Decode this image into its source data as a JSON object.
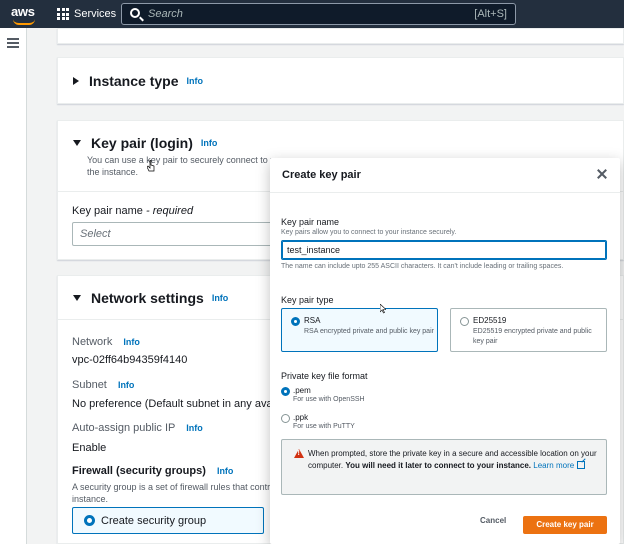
{
  "nav": {
    "logo": "aws",
    "services_label": "Services",
    "search_placeholder": "Search",
    "search_shortcut": "[Alt+S]"
  },
  "instance_type": {
    "title": "Instance type",
    "info": "Info"
  },
  "key_pair": {
    "title": "Key pair (login)",
    "info": "Info",
    "description_line1": "You can use a key pair to securely connect to y",
    "description_line2": "the instance.",
    "name_label": "Key pair name",
    "required": "- required",
    "select_placeholder": "Select"
  },
  "network": {
    "title": "Network settings",
    "info": "Info",
    "network_label": "Network",
    "network_info": "Info",
    "network_value": "vpc-02ff64b94359f4140",
    "subnet_label": "Subnet",
    "subnet_info": "Info",
    "subnet_value": "No preference (Default subnet in any availa",
    "public_ip_label": "Auto-assign public IP",
    "public_ip_info": "Info",
    "public_ip_value": "Enable",
    "firewall_label": "Firewall (security groups)",
    "firewall_info": "Info",
    "firewall_desc_line1": "A security group is a set of firewall rules that contr",
    "firewall_desc_line2": "instance.",
    "sg_option": "Create security group"
  },
  "modal": {
    "title": "Create key pair",
    "name_label": "Key pair name",
    "name_help": "Key pairs allow you to connect to your instance securely.",
    "name_value": "test_instance",
    "name_constraint": "The name can include upto 255 ASCII characters. It can't include leading or trailing spaces.",
    "type_label": "Key pair type",
    "types": [
      {
        "name": "RSA",
        "desc": "RSA encrypted private and public key pair",
        "selected": true
      },
      {
        "name": "ED25519",
        "desc": "ED25519 encrypted private and public key pair",
        "selected": false
      }
    ],
    "format_label": "Private key file format",
    "formats": [
      {
        "name": ".pem",
        "desc": "For use with OpenSSH",
        "selected": true
      },
      {
        "name": ".ppk",
        "desc": "For use with PuTTY",
        "selected": false
      }
    ],
    "warning_text": "When prompted, store the private key in a secure and accessible location on your computer.",
    "warning_bold": "You will need it later to connect to your instance.",
    "warning_link": "Learn more",
    "cancel_label": "Cancel",
    "create_label": "Create key pair"
  },
  "colors": {
    "nav_bg": "#232f3e",
    "accent": "#0073bb",
    "primary_button": "#ec7211",
    "warning_icon": "#d13212"
  }
}
